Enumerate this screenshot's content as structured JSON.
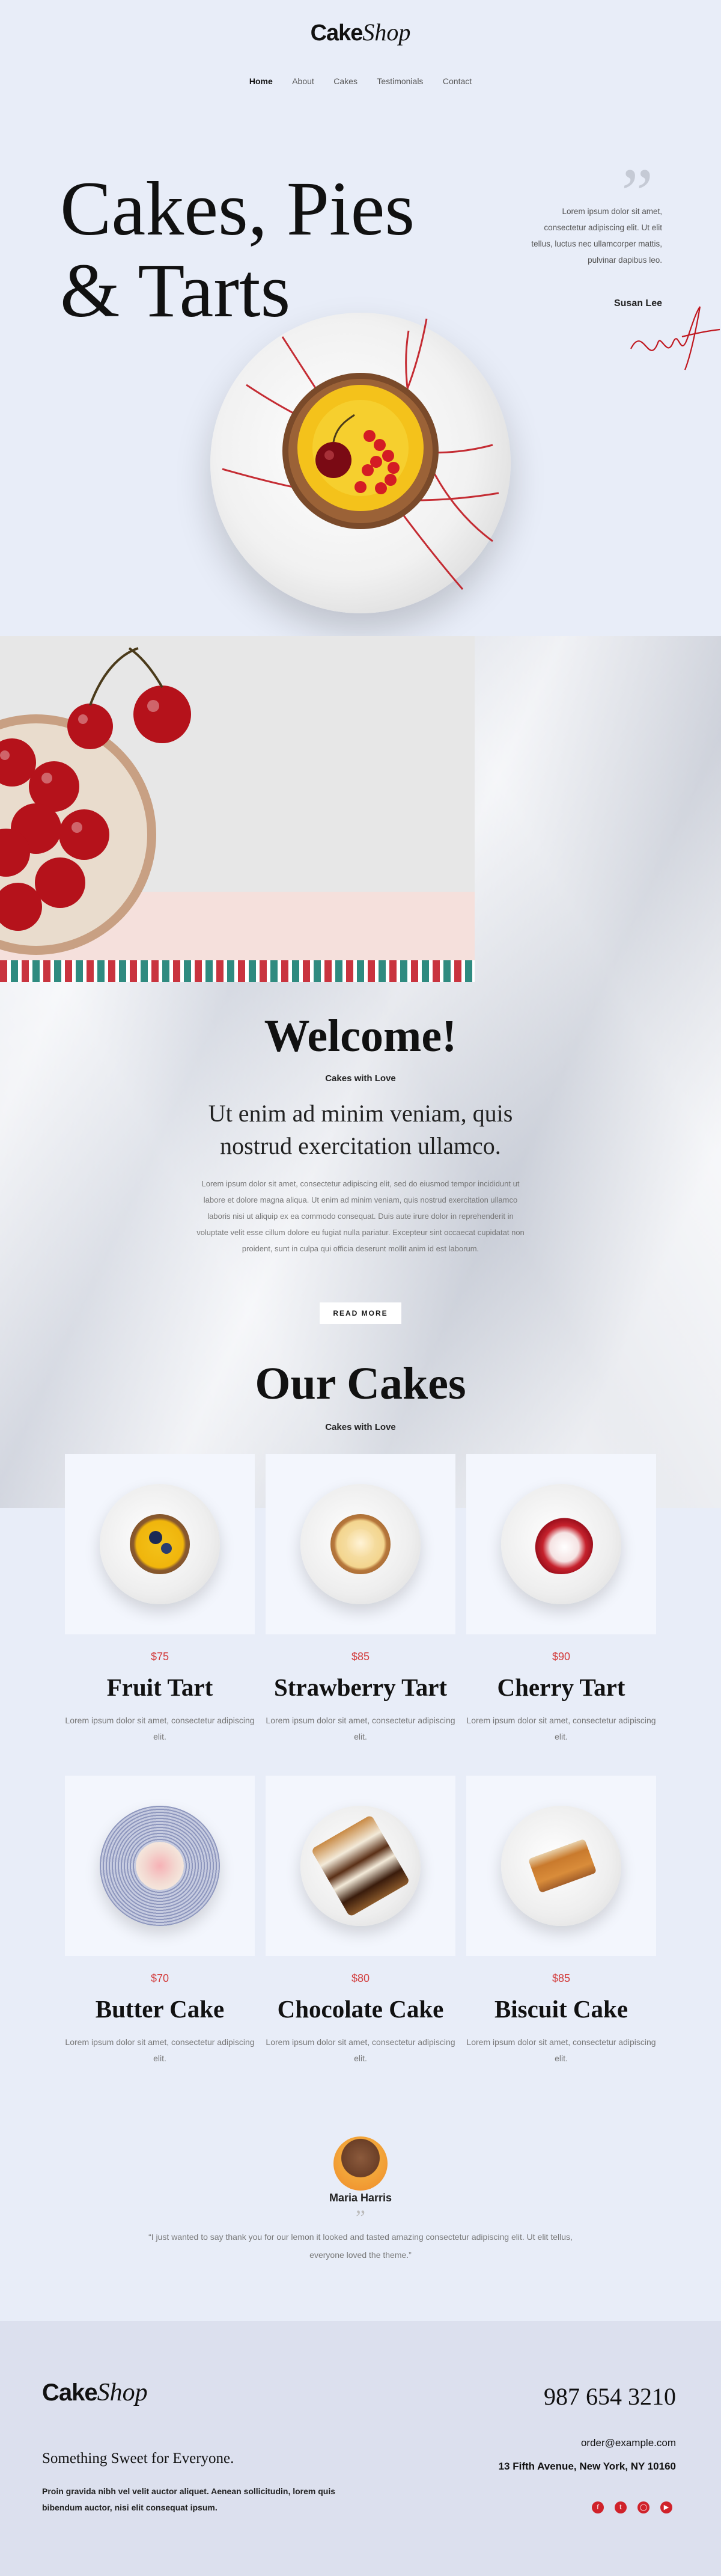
{
  "brand": {
    "name_main": "Cake",
    "name_script": "Shop",
    "tagline": ""
  },
  "nav": {
    "items": [
      "Home",
      "About",
      "Cakes",
      "Testimonials",
      "Contact"
    ],
    "active": "Home"
  },
  "hero": {
    "title_line1": "Cakes, Pies",
    "title_line2": "& Tarts",
    "quote_text": "Lorem ipsum dolor sit amet, consectetur adipiscing elit. Ut elit tellus, luctus nec ullamcorper mattis, pulvinar dapibus leo.",
    "quote_author": "Susan Lee",
    "quote_icon": "quote-icon"
  },
  "welcome": {
    "title": "Welcome!",
    "subtitle": "Cakes with Love",
    "lead": "Ut enim ad minim veniam, quis nostrud exercitation ullamco.",
    "body": "Lorem ipsum dolor sit amet, consectetur adipiscing elit, sed do eiusmod tempor incididunt ut labore et dolore magna aliqua. Ut enim ad minim veniam, quis nostrud exercitation ullamco laboris nisi ut aliquip ex ea commodo consequat. Duis aute irure dolor in reprehenderit in voluptate velit esse cillum dolore eu fugiat nulla pariatur. Excepteur sint occaecat cupidatat non proident, sunt in culpa qui officia deserunt mollit anim id est laborum.",
    "button_label": "READ MORE"
  },
  "cakes": {
    "title": "Our Cakes",
    "subtitle": "Cakes with Love",
    "items": [
      {
        "price": "$75",
        "name": "Fruit Tart",
        "desc": "Lorem ipsum dolor sit amet, consectetur adipiscing elit."
      },
      {
        "price": "$85",
        "name": "Strawberry Tart",
        "desc": "Lorem ipsum dolor sit amet, consectetur adipiscing elit."
      },
      {
        "price": "$90",
        "name": "Cherry Tart",
        "desc": "Lorem ipsum dolor sit amet, consectetur adipiscing elit."
      },
      {
        "price": "$70",
        "name": "Butter Cake",
        "desc": "Lorem ipsum dolor sit amet, consectetur adipiscing elit."
      },
      {
        "price": "$80",
        "name": "Chocolate Cake",
        "desc": "Lorem ipsum dolor sit amet, consectetur adipiscing elit."
      },
      {
        "price": "$85",
        "name": "Biscuit Cake",
        "desc": "Lorem ipsum dolor sit amet, consectetur adipiscing elit."
      }
    ]
  },
  "testimonial": {
    "name": "Maria Harris",
    "quote_mark": "”",
    "text": "“I just wanted to say thank you for our lemon it looked and tasted amazing consectetur adipiscing elit. Ut elit tellus, everyone loved the theme.”"
  },
  "footer": {
    "phone": "987 654 3210",
    "slogan": "Something Sweet for Everyone.",
    "text": "Proin gravida nibh vel velit auctor aliquet. Aenean sollicitudin, lorem quis bibendum auctor, nisi elit consequat ipsum.",
    "email": "order@example.com",
    "address": "13 Fifth Avenue, New York, NY 10160",
    "socials": [
      "facebook-icon",
      "twitter-icon",
      "instagram-icon",
      "youtube-icon"
    ]
  },
  "colors": {
    "background": "#e8edf8",
    "accent": "#d23a3a",
    "footer": "#dce0ee"
  }
}
